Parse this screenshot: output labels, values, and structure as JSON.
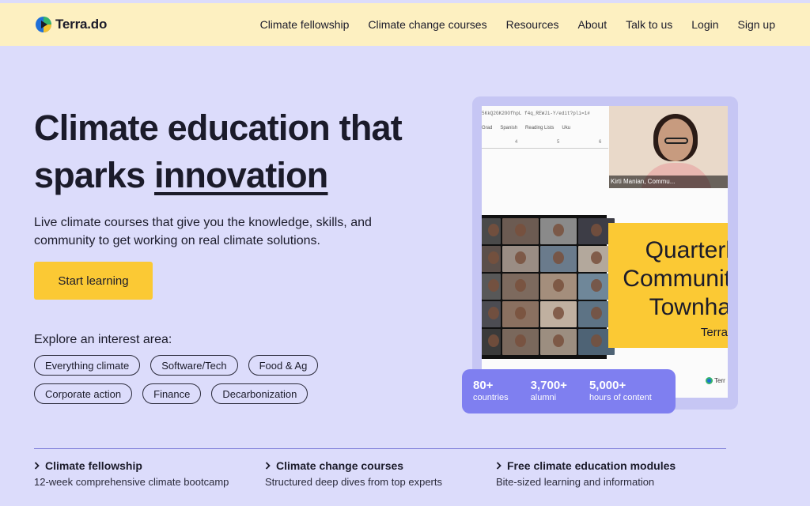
{
  "brand": {
    "name": "Terra.do",
    "colors": {
      "header_bg": "#fdf0c1",
      "page_bg": "#dcdcfb",
      "accent_yellow": "#fbc934",
      "stats_bg": "#7f7ff0"
    }
  },
  "nav": {
    "items": [
      "Climate fellowship",
      "Climate change courses",
      "Resources",
      "About",
      "Talk to us",
      "Login",
      "Sign up"
    ]
  },
  "hero": {
    "title_line1": "Climate education that",
    "title_line2_prefix": "sparks ",
    "title_line2_emphasis": "innovation",
    "subtitle": "Live climate courses that give you the knowledge, skills, and community to get working on real climate solutions.",
    "cta_label": "Start learning"
  },
  "interests": {
    "heading": "Explore an interest area:",
    "row1": [
      "Everything climate",
      "Software/Tech",
      "Food & Ag"
    ],
    "row2": [
      "Corporate action",
      "Finance",
      "Decarbonization"
    ]
  },
  "media": {
    "doc_url": "5KkQ2GK2OOfhpL f4q_REWJi-Y/edit?pli=1#",
    "doc_tabs": [
      "Grad",
      "Spanish",
      "Reading Lists",
      "Uku"
    ],
    "ruler_marks": [
      "4",
      "5",
      "6"
    ],
    "video_caption": "Kirti Manian, Commu...",
    "townhall_lines": [
      "Quarterl",
      "Communit",
      "Townha"
    ],
    "townhall_brand": "Terra",
    "mini_logo_text": "Terr",
    "gallery_colors": [
      "#4a4a4a",
      "#6c5b52",
      "#8a8a8a",
      "#3d3d46",
      "#5b4f4a",
      "#9a8d84",
      "#6a7b8c",
      "#b3a89c",
      "#585858",
      "#7d6a5e",
      "#a48e7c",
      "#6f8799",
      "#4c4c52",
      "#8a7060",
      "#c0b0a0",
      "#5d7385",
      "#3a3a3a",
      "#7a685c",
      "#9c8e80",
      "#4e6375"
    ]
  },
  "stats": [
    {
      "value": "80+",
      "label": "countries"
    },
    {
      "value": "3,700+",
      "label": "alumni"
    },
    {
      "value": "5,000+",
      "label": "hours of content"
    }
  ],
  "bottom": [
    {
      "title": "Climate fellowship",
      "desc": "12-week comprehensive climate bootcamp"
    },
    {
      "title": "Climate change courses",
      "desc": "Structured deep dives from top experts"
    },
    {
      "title": "Free climate education modules",
      "desc": "Bite-sized learning and information"
    }
  ]
}
